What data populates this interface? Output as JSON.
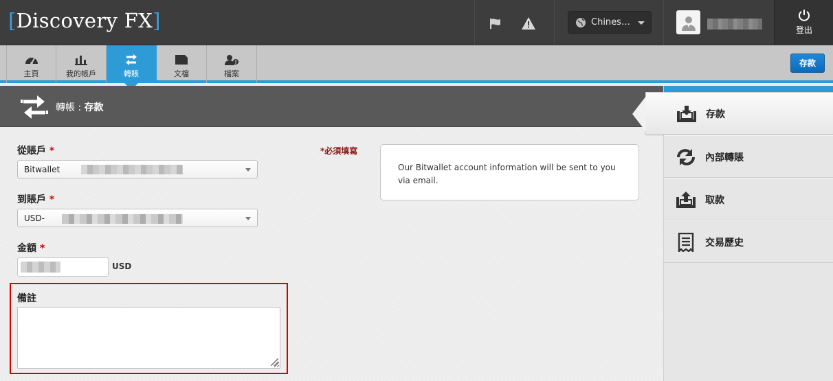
{
  "header": {
    "logo_left_bracket": "[",
    "logo_text": "Discovery FX",
    "logo_right_bracket": "]",
    "language": "Chines…",
    "logout_label": "登出",
    "icons": [
      "flag-icon",
      "warning-icon",
      "globe-icon",
      "user-avatar-icon",
      "power-icon"
    ]
  },
  "nav": {
    "tabs": [
      {
        "label": "主頁",
        "icon": "dashboard-icon"
      },
      {
        "label": "我的帳戶",
        "icon": "bar-chart-icon"
      },
      {
        "label": "轉賬",
        "icon": "transfer-icon",
        "active": true
      },
      {
        "label": "文檔",
        "icon": "document-icon"
      },
      {
        "label": "檔案",
        "icon": "profile-icon"
      }
    ],
    "deposit_button": "存款"
  },
  "page": {
    "title_prefix": "轉帳 : ",
    "title_main": "存款"
  },
  "form": {
    "from_account_label": "從賬戶",
    "from_account_value": "Bitwallet",
    "to_account_label": "到賬戶",
    "to_account_value": "USD-",
    "amount_label": "金額",
    "amount_unit": "USD",
    "notes_label": "備註",
    "required_marker": "*",
    "required_note": "*必須填寫",
    "info_text": "Our Bitwallet account information will be sent to you via email."
  },
  "sidebar": {
    "items": [
      {
        "label": "存款",
        "icon": "deposit-icon",
        "active": true
      },
      {
        "label": "內部轉賬",
        "icon": "refresh-icon"
      },
      {
        "label": "取款",
        "icon": "withdraw-icon"
      },
      {
        "label": "交易歷史",
        "icon": "history-icon"
      }
    ]
  },
  "colors": {
    "accent": "#2c9bd6",
    "header_bg": "#3d3d3d",
    "highlight_border": "#d40000",
    "required": "#c00000"
  }
}
